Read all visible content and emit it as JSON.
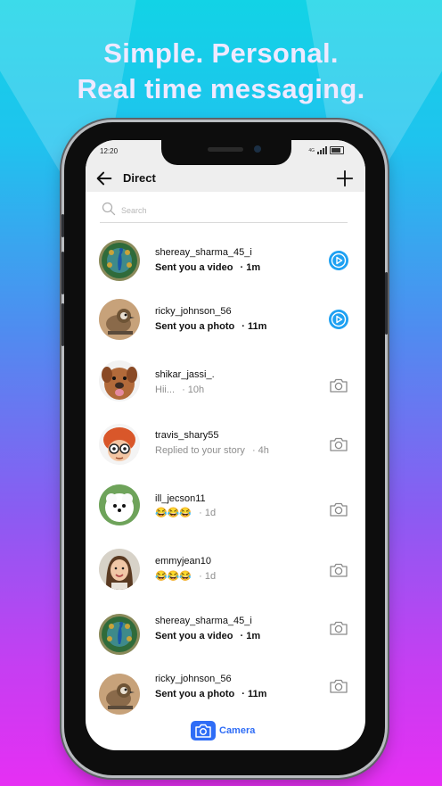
{
  "promo": {
    "line1": "Simple. Personal.",
    "line2": "Real time messaging."
  },
  "status_bar": {
    "time": "12:20",
    "network": "4G"
  },
  "header": {
    "title": "Direct"
  },
  "search": {
    "placeholder": "Search"
  },
  "threads": [
    {
      "username": "shereay_sharma_45_i",
      "message": "Sent you a video",
      "time": "· 1m",
      "unread": true,
      "action_icon": "play-circle-icon"
    },
    {
      "username": "ricky_johnson_56",
      "message": "Sent you a photo",
      "time": "· 11m",
      "unread": true,
      "action_icon": "play-circle-icon"
    },
    {
      "username": "shikar_jassi_.",
      "message": "Hii...",
      "time": "· 10h",
      "unread": false,
      "action_icon": "camera-icon"
    },
    {
      "username": "travis_shary55",
      "message": "Replied to your story",
      "time": "· 4h",
      "unread": false,
      "action_icon": "camera-icon"
    },
    {
      "username": "ill_jecson11",
      "message": "😂😂😂",
      "time": "· 1d",
      "unread": false,
      "action_icon": "camera-icon"
    },
    {
      "username": "emmyjean10",
      "message": "😂😂😂",
      "time": "· 1d",
      "unread": false,
      "action_icon": "camera-icon"
    },
    {
      "username": "shereay_sharma_45_i",
      "message": "Sent you a video",
      "time": "· 1m",
      "unread": true,
      "action_icon": "camera-icon"
    },
    {
      "username": "ricky_johnson_56",
      "message": "Sent you a photo",
      "time": "· 11m",
      "unread": true,
      "action_icon": "camera-icon"
    }
  ],
  "bottom": {
    "camera_label": "Camera"
  },
  "colors": {
    "accent": "#2f6df6",
    "play": "#1ea1f2",
    "muted": "#8e8e8e"
  }
}
